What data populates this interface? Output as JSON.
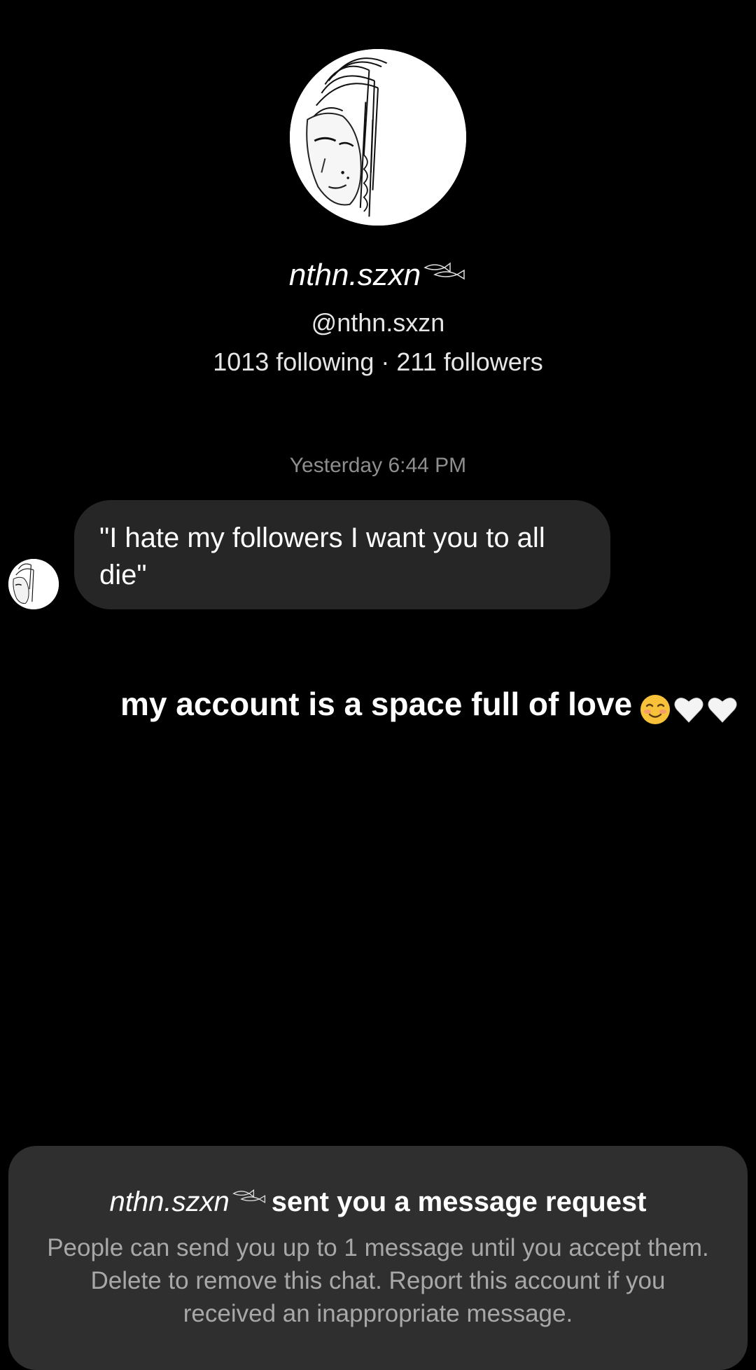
{
  "profile": {
    "display_name": "nthn.szxn",
    "handle": "@nthn.sxzn",
    "stats": "1013 following · 211 followers"
  },
  "thread": {
    "timestamp": "Yesterday 6:44 PM",
    "message": "\"I hate my followers I want you to all die\""
  },
  "overlay_caption": {
    "text": "my account is a space full of love",
    "emojis": [
      "smiling-blush-emoji",
      "white-heart-emoji",
      "white-heart-emoji"
    ]
  },
  "request": {
    "name": "nthn.szxn",
    "title_text": "sent you a message request",
    "body": "People can send you up to 1 message until you accept them. Delete to remove this chat. Report this account if you received an inappropriate message."
  },
  "colors": {
    "background": "#000000",
    "bubble": "#262626",
    "panel": "#2f2f2f",
    "muted_text": "#8e8e8e"
  }
}
